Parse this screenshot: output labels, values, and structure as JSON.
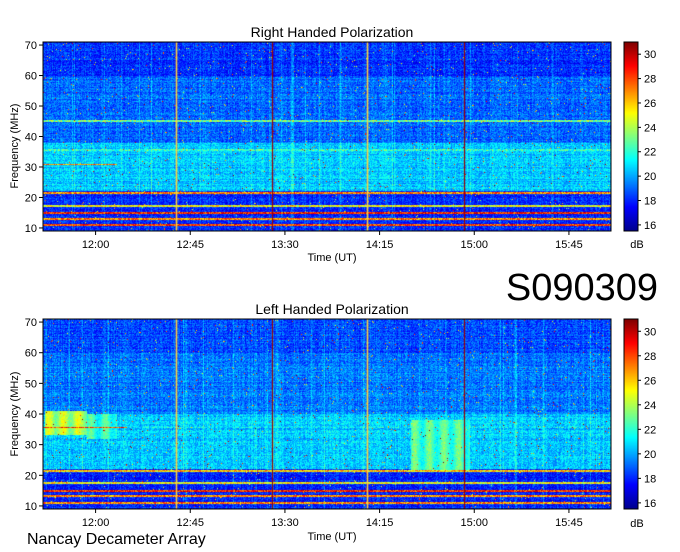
{
  "figure": {
    "event_id": "S090309",
    "observatory": "Nancay Decameter Array"
  },
  "colors": {
    "colormap": [
      "#00008f",
      "#0000ff",
      "#0080ff",
      "#00ffff",
      "#80ff80",
      "#ffff00",
      "#ff8000",
      "#ff0000",
      "#800000"
    ],
    "marker_yellow": "#ffd23c",
    "marker_dark": "#9a0000"
  },
  "chart_data": [
    {
      "type": "heatmap",
      "title": "Right Handed Polarization",
      "xlabel": "Time (UT)",
      "ylabel": "Frequency (MHz)",
      "x_ticks": [
        "12:00",
        "12:45",
        "13:30",
        "14:15",
        "15:00",
        "15:45"
      ],
      "x_tick_minutes": [
        720,
        765,
        810,
        855,
        900,
        945
      ],
      "xlim_minutes": [
        695,
        965
      ],
      "y_ticks": [
        10,
        20,
        30,
        40,
        50,
        60,
        70
      ],
      "ylim": [
        9,
        71
      ],
      "colorbar": {
        "label": "dB",
        "ticks": [
          16,
          18,
          20,
          22,
          24,
          26,
          28,
          30
        ],
        "range": [
          15.5,
          31
        ]
      },
      "background_levels": [
        {
          "f_min": 9,
          "f_max": 22,
          "level": 18
        },
        {
          "f_min": 22,
          "f_max": 38,
          "level": 20.5
        },
        {
          "f_min": 38,
          "f_max": 60,
          "level": 19
        },
        {
          "f_min": 60,
          "f_max": 71,
          "level": 18.2
        }
      ],
      "interference_bands": [
        {
          "f_min": 10.5,
          "f_max": 11.2,
          "level": 30,
          "t_start": 695,
          "t_end": 965
        },
        {
          "f_min": 12.5,
          "f_max": 13.2,
          "level": 29,
          "t_start": 695,
          "t_end": 965
        },
        {
          "f_min": 14.5,
          "f_max": 15.3,
          "level": 30.5,
          "t_start": 695,
          "t_end": 965
        },
        {
          "f_min": 16.8,
          "f_max": 17.6,
          "level": 27,
          "t_start": 695,
          "t_end": 965
        },
        {
          "f_min": 21.2,
          "f_max": 21.8,
          "level": 29,
          "t_start": 695,
          "t_end": 965
        },
        {
          "f_min": 30.6,
          "f_max": 31.1,
          "level": 29,
          "t_start": 695,
          "t_end": 730
        },
        {
          "f_min": 35.3,
          "f_max": 35.8,
          "level": 24,
          "t_start": 695,
          "t_end": 965
        },
        {
          "f_min": 44.8,
          "f_max": 45.3,
          "level": 25,
          "t_start": 695,
          "t_end": 965
        }
      ],
      "emission_regions": [],
      "time_markers": [
        {
          "t": 758,
          "color": "yellow"
        },
        {
          "t": 804,
          "color": "dark"
        },
        {
          "t": 849,
          "color": "yellow"
        },
        {
          "t": 895,
          "color": "dark"
        }
      ]
    },
    {
      "type": "heatmap",
      "title": "Left Handed Polarization",
      "xlabel": "Time (UT)",
      "ylabel": "Frequency (MHz)",
      "x_ticks": [
        "12:00",
        "12:45",
        "13:30",
        "14:15",
        "15:00",
        "15:45"
      ],
      "x_tick_minutes": [
        720,
        765,
        810,
        855,
        900,
        945
      ],
      "xlim_minutes": [
        695,
        965
      ],
      "y_ticks": [
        10,
        20,
        30,
        40,
        50,
        60,
        70
      ],
      "ylim": [
        9,
        71
      ],
      "colorbar": {
        "label": "dB",
        "ticks": [
          16,
          18,
          20,
          22,
          24,
          26,
          28,
          30
        ],
        "range": [
          15.5,
          31
        ]
      },
      "background_levels": [
        {
          "f_min": 9,
          "f_max": 22,
          "level": 18
        },
        {
          "f_min": 22,
          "f_max": 40,
          "level": 20.5
        },
        {
          "f_min": 40,
          "f_max": 60,
          "level": 19.3
        },
        {
          "f_min": 60,
          "f_max": 71,
          "level": 18.5
        }
      ],
      "interference_bands": [
        {
          "f_min": 10.5,
          "f_max": 11.2,
          "level": 29,
          "t_start": 695,
          "t_end": 965
        },
        {
          "f_min": 12.8,
          "f_max": 13.5,
          "level": 29,
          "t_start": 695,
          "t_end": 965
        },
        {
          "f_min": 14.5,
          "f_max": 15.3,
          "level": 30.5,
          "t_start": 695,
          "t_end": 965
        },
        {
          "f_min": 17.0,
          "f_max": 17.8,
          "level": 27,
          "t_start": 695,
          "t_end": 965
        },
        {
          "f_min": 21.0,
          "f_max": 21.6,
          "level": 28,
          "t_start": 695,
          "t_end": 965
        },
        {
          "f_min": 35.3,
          "f_max": 35.9,
          "level": 30,
          "t_start": 695,
          "t_end": 735
        },
        {
          "f_min": 35.3,
          "f_max": 35.7,
          "level": 23,
          "t_start": 735,
          "t_end": 965
        }
      ],
      "emission_regions": [
        {
          "t_start": 696,
          "t_end": 716,
          "f_min": 33,
          "f_max": 41,
          "level": 24.5
        },
        {
          "t_start": 716,
          "t_end": 730,
          "f_min": 32,
          "f_max": 40,
          "level": 22.5
        },
        {
          "t_start": 870,
          "t_end": 898,
          "f_min": 21,
          "f_max": 38,
          "level": 22.8
        }
      ],
      "time_markers": [
        {
          "t": 758,
          "color": "yellow"
        },
        {
          "t": 804,
          "color": "dark"
        },
        {
          "t": 849,
          "color": "yellow"
        },
        {
          "t": 895,
          "color": "dark"
        }
      ]
    }
  ]
}
